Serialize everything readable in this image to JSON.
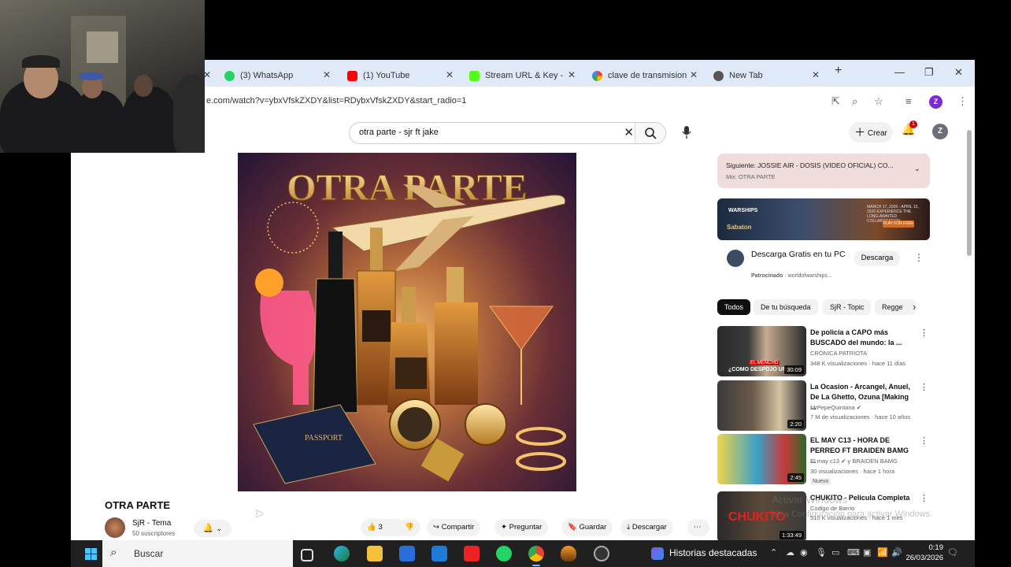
{
  "browser": {
    "tabs": [
      {
        "label": "(3) WhatsApp",
        "icon": "whatsapp-icon",
        "color": "#25d366"
      },
      {
        "label": "(1) YouTube",
        "icon": "youtube-icon",
        "color": "#ff0000"
      },
      {
        "label": "Stream URL & Key - ",
        "icon": "kick-icon",
        "color": "#53fc18"
      },
      {
        "label": "clave de transmision",
        "icon": "google-icon",
        "color": "#4285f4"
      },
      {
        "label": "New Tab",
        "icon": "chrome-icon",
        "color": "#555555"
      }
    ],
    "url": "e.com/watch?v=ybxVfskZXDY&list=RDybxVfskZXDY&start_radio=1",
    "profile_initial": "Z"
  },
  "youtube": {
    "search_value": "otra parte - sjr ft jake",
    "create_label": "Crear",
    "notification_count": "1",
    "avatar_initial": "Z",
    "cover_title": "OTRA PARTE",
    "video_title": "OTRA PARTE",
    "channel_name": "SjR - Tema",
    "channel_subs": "50 suscriptores",
    "like_count": "3",
    "actions": {
      "share": "Compartir",
      "ask": "Preguntar",
      "save": "Guardar",
      "download": "Descargar"
    },
    "next_up": {
      "title": "Siguiente: JOSSIE AIR - DOSIS (VIDEO OFICIAL) CO...",
      "mix": "Mix: OTRA PARTE"
    },
    "ad": {
      "banner_brand": "WARSHIPS",
      "banner_partner": "Sabaton",
      "banner_text": "MARCH 17, 2026 - APRIL 15, 2026 EXPERIENCE THE LONG-AWAITED COLLABORATION",
      "banner_button": "PLAY FOR FREE",
      "title": "Descarga Gratis en tu PC",
      "sponsored": "Patrocinado",
      "domain": "· worldofwarships...",
      "button": "Descarga"
    },
    "chips": [
      "Todos",
      "De tu búsqueda",
      "SjR - Topic",
      "Regge"
    ],
    "recommendations": [
      {
        "title": "De policía a CAPO más BUSCADO del mundo: la ...",
        "channel": "CRÓNICA PATRIOTA",
        "meta": "348 K visualizaciones · hace 11 días",
        "duration": "30:09",
        "thumb_caption": "¿COMO DESPOJÓ UN P...",
        "thumb_tag": "EL MENCHO",
        "badge": ""
      },
      {
        "title": "La Ocasion - Arcangel, Anuel, De La Ghetto, Ozuna [Making ...",
        "channel": "MrPepeQuintana ✔",
        "meta": "7 M de visualizaciones · hace 10 años",
        "duration": "2:20",
        "thumb_caption": "",
        "thumb_tag": "",
        "badge": ""
      },
      {
        "title": "EL MAY C13 - HORA DE PERREO FT BRAIDEN BAMG ...",
        "channel": "El may c13 ✔ y BRAIDEN BAMG",
        "meta": "30 visualizaciones · hace 1 hora",
        "duration": "2:45",
        "thumb_caption": "",
        "thumb_tag": "",
        "badge": "Nuevo"
      },
      {
        "title": "CHUKITO - Pelicula Completa",
        "channel": "Codigo de Barrio",
        "meta": "510 K visualizaciones · hace 1 mes",
        "duration": "1:33:49",
        "thumb_caption": "CHUKITO",
        "thumb_tag": "",
        "badge": ""
      }
    ],
    "watermark_line1": "Activar Windows",
    "watermark_line2": "Ve a Configuración para activar Windows."
  },
  "taskbar": {
    "search_label": "Buscar",
    "news_label": "Historias destacadas",
    "time": "0:19",
    "date": "26/03/2026"
  }
}
